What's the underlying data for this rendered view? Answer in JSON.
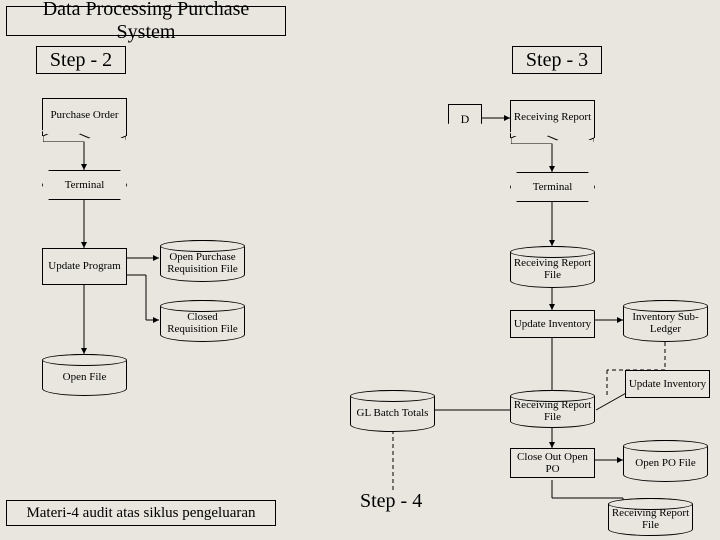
{
  "title": "Data Processing Purchase System",
  "steps": {
    "s2": "Step - 2",
    "s3": "Step - 3",
    "s4": "Step - 4"
  },
  "footer": "Materi-4 audit atas siklus pengeluaran",
  "connector_d": "D",
  "nodes": {
    "purchase_order": "Purchase Order",
    "receiving_report": "Receiving Report",
    "terminal_left": "Terminal",
    "terminal_right": "Terminal",
    "update_program": "Update Program",
    "open_purchase_req_file": "Open Purchase Requisition File",
    "closed_req_file": "Closed Requisition File",
    "open_file": "Open File",
    "receiving_report_file_1": "Receiving Report File",
    "update_inventory_1": "Update Inventory",
    "inventory_sub_ledger": "Inventory Sub-Ledger",
    "update_inventory_2": "Update Inventory",
    "gl_batch_totals": "GL Batch Totals",
    "receiving_report_file_2": "Receiving Report File",
    "close_out_open_po": "Close Out Open PO",
    "open_po_file": "Open PO File",
    "receiving_report_file_3": "Receiving Report File"
  }
}
